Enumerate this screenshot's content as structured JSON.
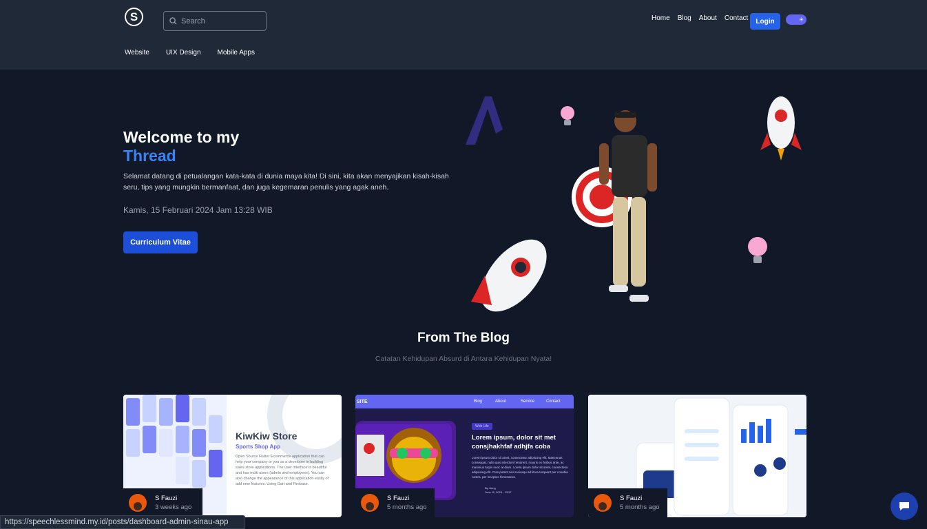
{
  "header": {
    "logo_letter": "S",
    "search_placeholder": "Search",
    "nav": [
      "Home",
      "Blog",
      "About",
      "Contact"
    ],
    "login_label": "Login",
    "toggle_icon": "sun-icon",
    "subnav": [
      "Website",
      "UIX Design",
      "Mobile Apps"
    ]
  },
  "hero": {
    "title_line1": "Welcome to my",
    "title_accent": "Thread",
    "description": "Selamat datang di petualangan kata-kata di dunia maya kita! Di sini, kita akan menyajikan kisah-kisah seru, tips yang mungkin bermanfaat, dan juga kegemaran penulis yang agak aneh.",
    "date": "Kamis, 15 Februari 2024 Jam 13:28 WIB",
    "cv_button": "Curriculum Vitae"
  },
  "blog": {
    "title": "From The Blog",
    "subtitle": "Catatan Kehidupan Absurd di Antara Kehidupan Nyata!",
    "posts": [
      {
        "author": "S Fauzi",
        "time": "3 weeks ago",
        "thumb_title": "KiwKiw Store",
        "thumb_subtitle": "Sports Shop App",
        "thumb_text": "Open Source Flutter Ecommerce application that can help your company or you as a developer in building sales store applications. The user interface is beautiful and has multi users (admin and employees). You can also change the appearance of this application easily or add new features. Using Dart and Firebase."
      },
      {
        "author": "S Fauzi",
        "time": "5 months ago",
        "thumb_brand": "SITE",
        "thumb_menu": [
          "Blog",
          "About",
          "Service",
          "Contact"
        ],
        "thumb_tag": "Web Life",
        "thumb_title": "Lorem ipsum, dolor sit met consjhakhfaf adhjfa coba",
        "thumb_text": "Lorem ipsum dolor sit amet, consectetur adipiscing elit. Maecenas consequat, nulla quis interdum hendrerit, mauris ex finibus ante, ac maximus turpis nunc at diam. Lorem ipsum dolor sit amet, consectetur adipiscing elit. Cras potent nisi sociosqu ad litora torquent per conubia nostra, per inceptos himenaeos.",
        "thumb_by": "By. Aung",
        "thumb_date": "June 11, 2023 - 13:37"
      },
      {
        "author": "S Fauzi",
        "time": "5 months ago"
      }
    ]
  },
  "statusbar_url": "https://speechlessmind.my.id/posts/dashboard-admin-sinau-app",
  "colors": {
    "accent": "#3b82f6",
    "button": "#1d4ed8",
    "background": "#111827",
    "header": "#1f2937"
  }
}
